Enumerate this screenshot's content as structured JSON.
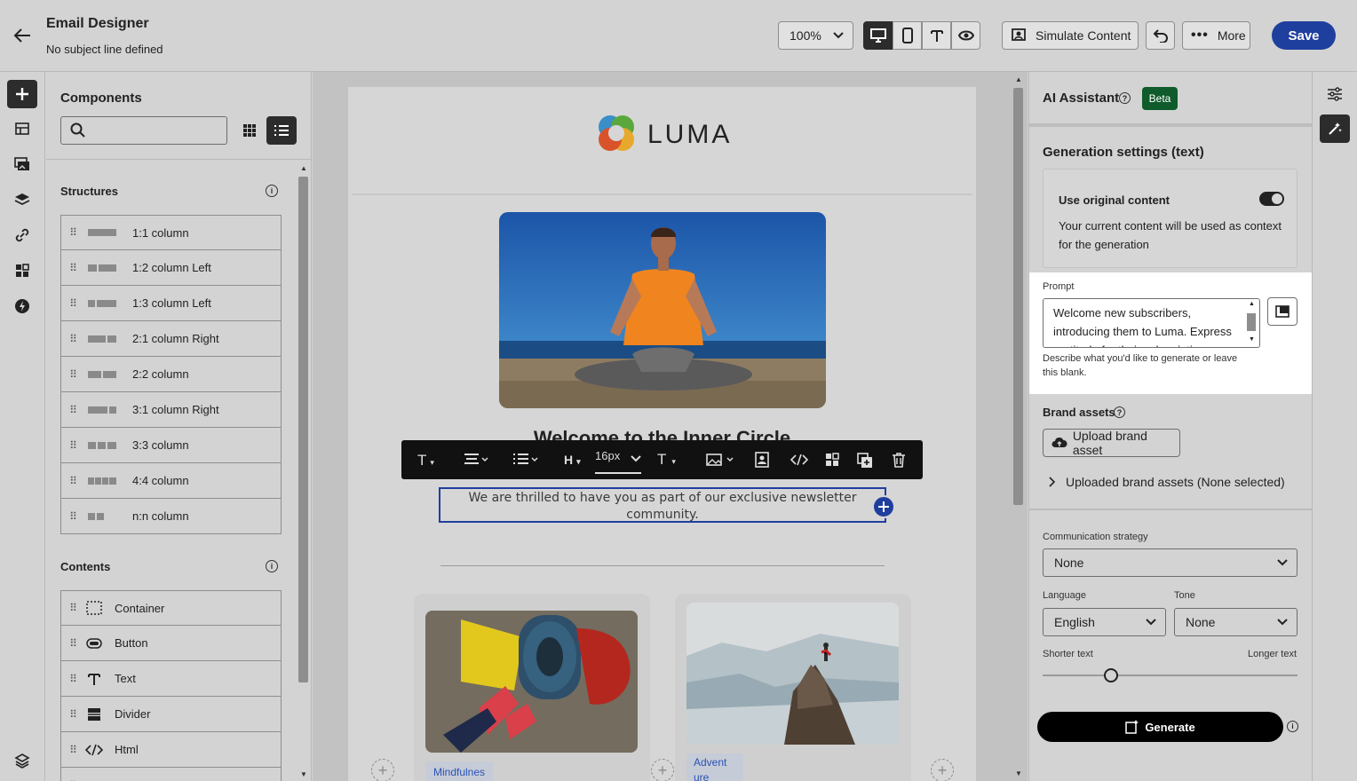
{
  "header": {
    "title": "Email Designer",
    "subtitle": "No subject line defined",
    "zoom": "100%",
    "simulate_label": "Simulate Content",
    "more_label": "More",
    "save_label": "Save"
  },
  "components": {
    "title": "Components",
    "search_placeholder": "",
    "structures_title": "Structures",
    "structures": [
      "1:1 column",
      "1:2 column Left",
      "1:3 column Left",
      "2:1 column Right",
      "2:2 column",
      "3:1 column Right",
      "3:3 column",
      "4:4 column",
      "n:n column"
    ],
    "contents_title": "Contents",
    "contents": [
      "Container",
      "Button",
      "Text",
      "Divider",
      "Html"
    ]
  },
  "email": {
    "brand": "LUMA",
    "heading": "Welcome to the Inner Circle",
    "body_text": "We are thrilled to have you as part of our exclusive newsletter community.",
    "toolbar_font_size": "16px",
    "tag1": "Mindfulnes",
    "tag2": "Advent",
    "tag2_cont": "ure"
  },
  "ai": {
    "title": "AI Assistant",
    "beta": "Beta",
    "gen_settings": "Generation settings (text)",
    "use_original": "Use original content",
    "use_original_desc": "Your current content will be used as context for the generation",
    "prompt_label": "Prompt",
    "prompt_text": "Welcome new subscribers, introducing them to Luma. Express gratitude for their subscription",
    "prompt_help": "Describe what you'd like to generate or leave this blank.",
    "brand_assets": "Brand assets",
    "upload_label": "Upload brand asset",
    "uploaded_label": "Uploaded brand assets (None selected)",
    "strategy_label": "Communication strategy",
    "strategy_value": "None",
    "language_label": "Language",
    "language_value": "English",
    "tone_label": "Tone",
    "tone_value": "None",
    "shorter": "Shorter text",
    "longer": "Longer text",
    "generate_label": "Generate",
    "length_level": 0.24
  },
  "colors": {
    "accent": "#1f3f9f",
    "beta_bg": "#0f5b2b"
  }
}
